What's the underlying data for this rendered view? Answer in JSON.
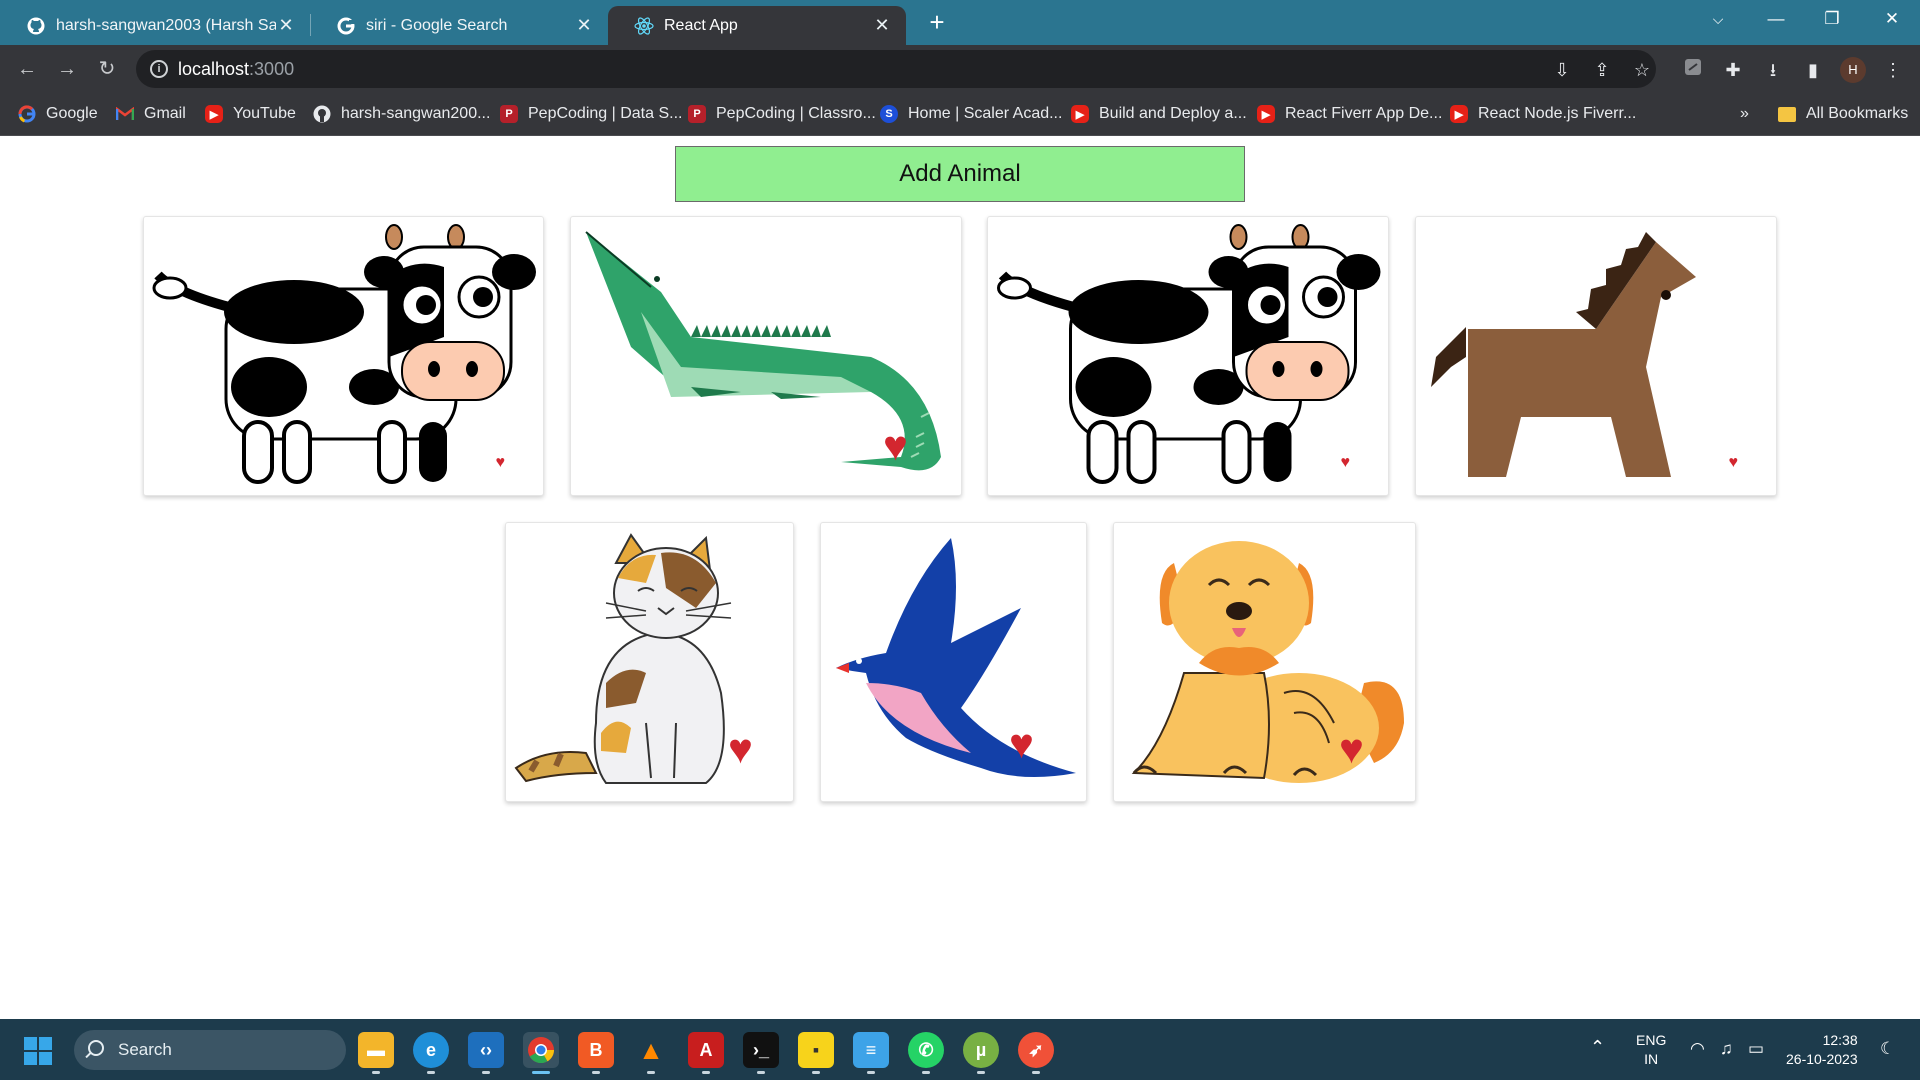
{
  "browser": {
    "tabs": [
      {
        "title": "harsh-sangwan2003 (Harsh Sangwan)",
        "icon": "github-icon"
      },
      {
        "title": "siri - Google Search",
        "icon": "google-icon"
      },
      {
        "title": "React App",
        "icon": "react-icon"
      }
    ],
    "url_host": "localhost",
    "url_port": ":3000",
    "profile_initial": "H",
    "bookmarks": [
      {
        "label": "Google",
        "icon": "google-icon"
      },
      {
        "label": "Gmail",
        "icon": "gmail-icon"
      },
      {
        "label": "YouTube",
        "icon": "youtube-icon"
      },
      {
        "label": "harsh-sangwan200...",
        "icon": "github-icon"
      },
      {
        "label": "PepCoding | Data S...",
        "icon": "pepcoding-icon"
      },
      {
        "label": "PepCoding | Classro...",
        "icon": "pepcoding-icon"
      },
      {
        "label": "Home | Scaler Acad...",
        "icon": "scaler-icon"
      },
      {
        "label": "Build and Deploy a...",
        "icon": "youtube-icon"
      },
      {
        "label": "React Fiverr App De...",
        "icon": "youtube-icon"
      },
      {
        "label": "React Node.js Fiverr...",
        "icon": "youtube-icon"
      }
    ],
    "overflow_label": "»",
    "all_bookmarks": "All Bookmarks"
  },
  "app": {
    "add_button": "Add Animal",
    "animals": [
      {
        "type": "cow",
        "heart": "small"
      },
      {
        "type": "gator",
        "heart": "big"
      },
      {
        "type": "cow",
        "heart": "small"
      },
      {
        "type": "horse",
        "heart": "small"
      },
      {
        "type": "cat",
        "heart": "big"
      },
      {
        "type": "bird",
        "heart": "big"
      },
      {
        "type": "dog",
        "heart": "big"
      }
    ]
  },
  "taskbar": {
    "search_label": "Search",
    "lang_top": "ENG",
    "lang_bottom": "IN",
    "time": "12:38",
    "date": "26-10-2023",
    "apps": [
      "file-explorer",
      "edge",
      "vscode",
      "chrome",
      "brave",
      "vlc",
      "acrobat",
      "terminal",
      "sticky-notes",
      "notepad",
      "whatsapp",
      "utorrent",
      "swift"
    ]
  },
  "colors": {
    "add_button": "#90ee90",
    "heart": "#d3262f",
    "tabstrip": "#2b7590",
    "taskbar": "#1d3b4c"
  }
}
